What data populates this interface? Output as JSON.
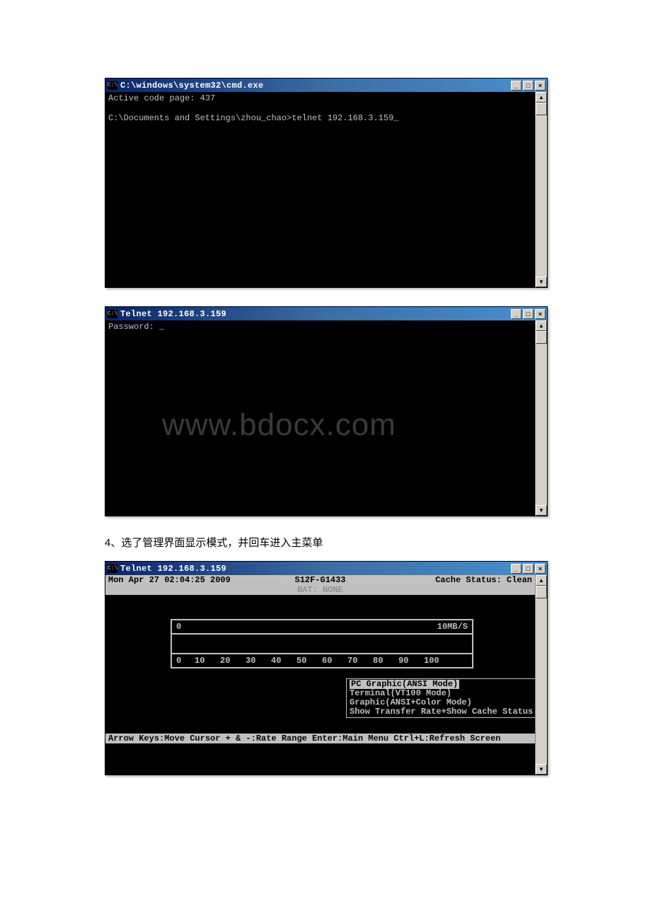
{
  "window1": {
    "title": "C:\\windows\\system32\\cmd.exe",
    "icon_label": "C:\\",
    "lines": {
      "l1": "Active code page: 437",
      "l2": "",
      "l3": "C:\\Documents and Settings\\zhou_chao>telnet 192.168.3.159_"
    }
  },
  "window2": {
    "title": "Telnet 192.168.3.159",
    "icon_label": "C:\\",
    "prompt": "Password: _",
    "watermark": "www.bdocx.com"
  },
  "caption": "4、选了管理界面显示模式，并回车进入主菜单",
  "window3": {
    "title": "Telnet 192.168.3.159",
    "icon_label": "C:\\",
    "header": {
      "left": "Mon Apr 27 02:04:25 2009",
      "center": "S12F-G1433",
      "right": "Cache Status: Clean"
    },
    "sub": "BAT: NONE",
    "graph": {
      "left_val": "0",
      "right_val": "10MB/S",
      "ticks": [
        "0",
        "10",
        "20",
        "30",
        "40",
        "50",
        "60",
        "70",
        "80",
        "90",
        "100"
      ]
    },
    "menu": {
      "opt1": "PC Graphic(ANSI Mode)",
      "opt2": "Terminal(VT100 Mode)",
      "opt3": "Graphic(ANSI+Color Mode)",
      "opt4": "Show Transfer Rate+Show Cache Status"
    },
    "footer": "Arrow Keys:Move Cursor + & -:Rate Range Enter:Main Menu Ctrl+L:Refresh Screen"
  },
  "controls": {
    "min": "_",
    "max": "□",
    "close": "×",
    "up": "▲",
    "down": "▼"
  }
}
